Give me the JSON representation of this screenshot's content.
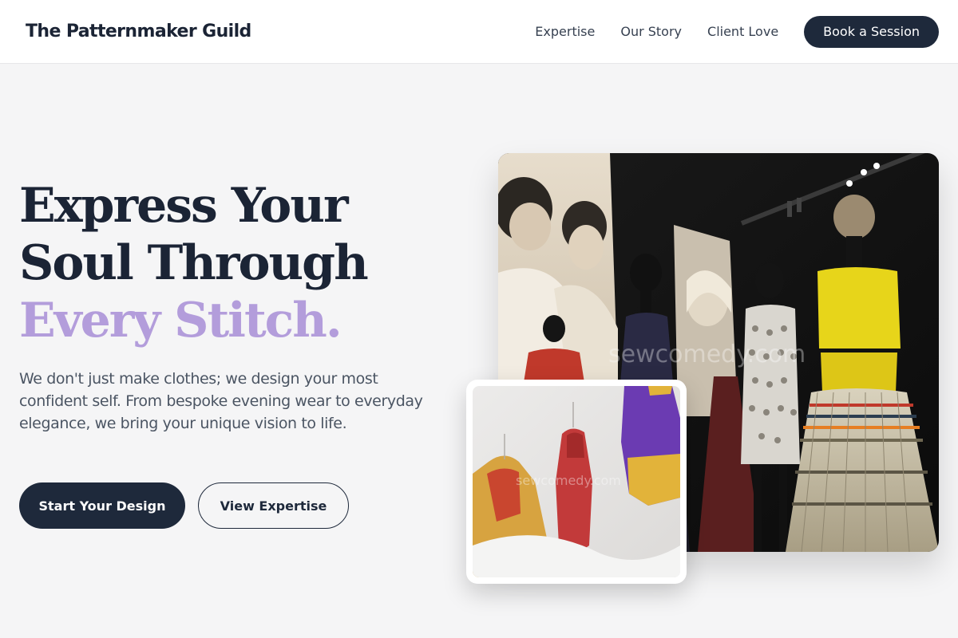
{
  "nav": {
    "brand": "The Patternmaker Guild",
    "links": [
      "Expertise",
      "Our Story",
      "Client Love"
    ],
    "cta": "Book a Session"
  },
  "hero": {
    "title_line1": "Express Your",
    "title_line2": "Soul Through",
    "title_line3": "Every Stitch.",
    "description": "We don't just make clothes; we design your most confident self. From bespoke evening wear to everyday elegance, we bring your unique vision to life.",
    "primary_button": "Start Your Design",
    "secondary_button": "View Expertise"
  },
  "images": {
    "main_watermark": "sewcomedy.com",
    "inset_watermark": "sewcomedy.com"
  },
  "colors": {
    "navy": "#1e293b",
    "accent_lavender": "#b39ddb",
    "background": "#f5f5f6"
  }
}
